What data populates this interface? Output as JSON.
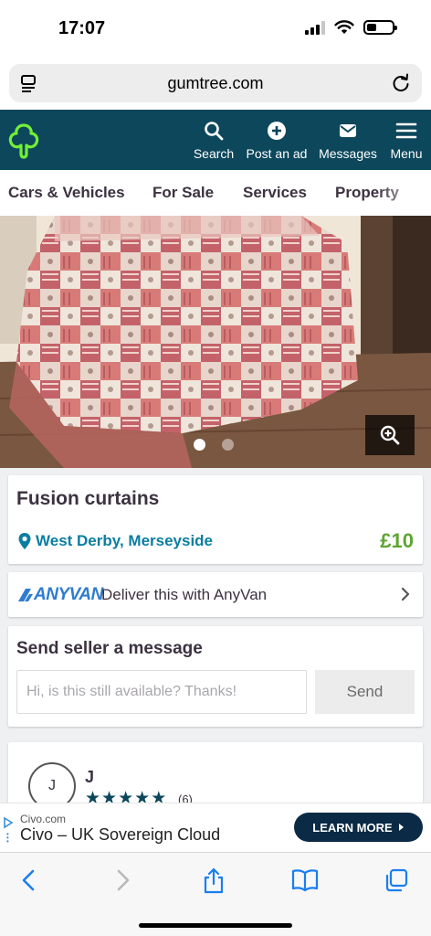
{
  "status": {
    "time": "17:07"
  },
  "browser": {
    "url": "gumtree.com"
  },
  "header": {
    "nav": [
      {
        "label": "Search",
        "icon": "search-icon"
      },
      {
        "label": "Post an ad",
        "icon": "plus-icon"
      },
      {
        "label": "Messages",
        "icon": "envelope-icon"
      },
      {
        "label": "Menu",
        "icon": "hamburger-icon"
      }
    ]
  },
  "categories": [
    "Cars & Vehicles",
    "For Sale",
    "Services",
    "Property"
  ],
  "gallery": {
    "image_count": 2,
    "active_index": 0
  },
  "listing": {
    "title": "Fusion curtains",
    "location": "West Derby, Merseyside",
    "price": "£10"
  },
  "delivery": {
    "logo_text": "ANYVAN",
    "label": "Deliver this with AnyVan"
  },
  "message": {
    "title": "Send seller a message",
    "placeholder": "Hi, is this still available? Thanks!",
    "send_label": "Send"
  },
  "seller": {
    "initial": "J",
    "name": "J",
    "stars": 5,
    "rating_count": "(6)"
  },
  "ad": {
    "domain": "Civo.com",
    "headline": "Civo – UK Sovereign Cloud",
    "cta": "LEARN MORE"
  },
  "colors": {
    "header_bg": "#0d475c",
    "logo_green": "#72ef36",
    "price_green": "#5da531",
    "link_blue": "#0a7ea1",
    "ios_blue": "#1a7ef0"
  }
}
